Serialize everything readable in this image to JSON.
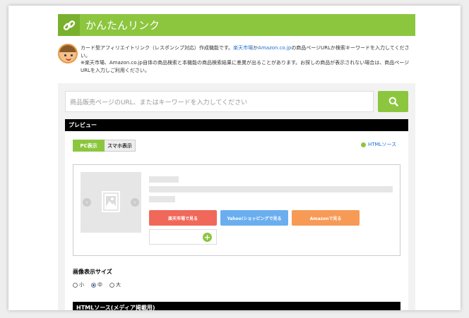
{
  "header": {
    "title": "かんたんリンク",
    "logo_icon": "link-icon"
  },
  "description": {
    "line1_pre": "カード型アフィリエイトリンク（レスポンシブ対応）作成機能です。",
    "link_rakuten": "楽天市場",
    "line1_mid": "か",
    "link_amazon": "Amazon.co.jp",
    "line1_post": "の商品ページURLか検索キーワードを入力してください。",
    "line2": "※楽天市場、Amazon.co.jp自体の商品検索と本機能の商品検索結果に差異が出ることがあります。お探しの商品が表示されない場合は、商品ページURLを入力しご利用ください。"
  },
  "search": {
    "placeholder": "商品販売ページのURL、またはキーワードを入力してください",
    "button_icon": "search-icon"
  },
  "preview": {
    "title": "プレビュー",
    "tabs": [
      {
        "label": "PC表示",
        "active": true
      },
      {
        "label": "スマホ表示",
        "active": false
      }
    ],
    "html_source_link": "HTMLソース",
    "buttons": [
      {
        "label": "楽天市場で見る",
        "color": "#f0685a"
      },
      {
        "label": "Yahoo!ショッピングで見る",
        "color": "#6aaef0"
      },
      {
        "label": "Amazonで見る",
        "color": "#f79a56"
      }
    ]
  },
  "image_size": {
    "label": "画像表示サイズ",
    "options": [
      {
        "label": "小",
        "selected": false
      },
      {
        "label": "中",
        "selected": true
      },
      {
        "label": "大",
        "selected": false
      }
    ]
  },
  "html_source_bar": "HTMLソース(メディア掲載用)",
  "colors": {
    "accent": "#8cc63f",
    "link": "#1a6dd4"
  }
}
